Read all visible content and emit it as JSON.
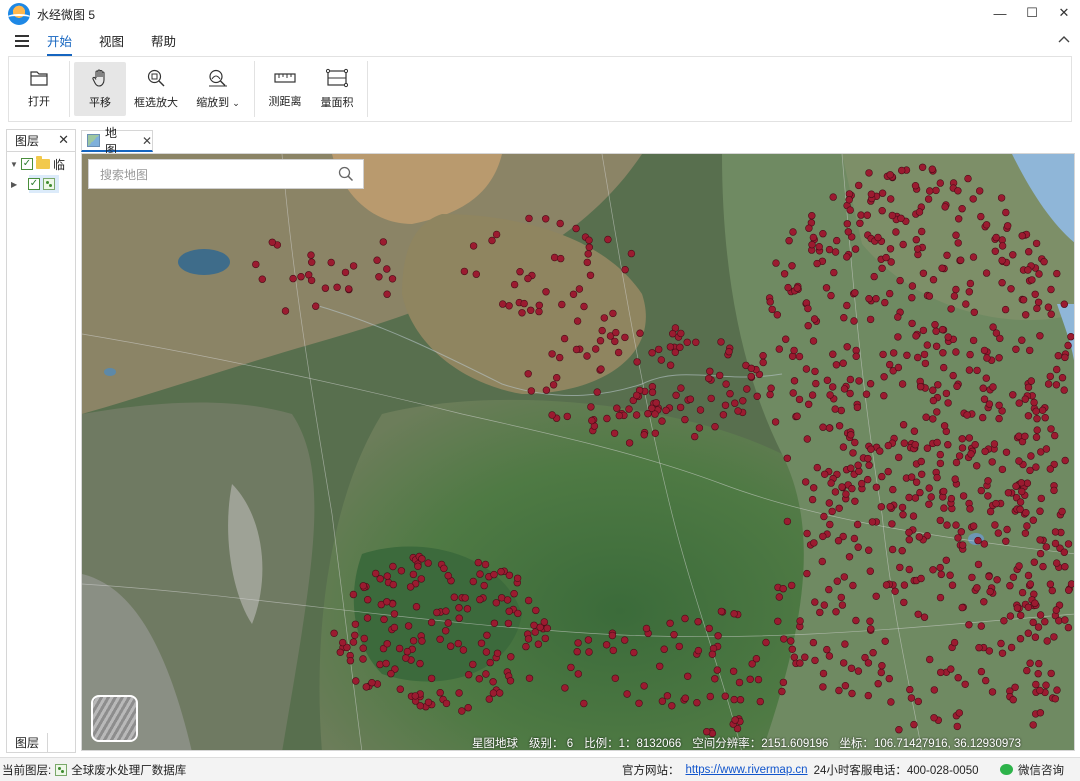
{
  "app": {
    "title": "水经微图 5"
  },
  "window": {
    "minimize": "—",
    "maximize": "☐",
    "close": "✕"
  },
  "menu": {
    "items": [
      "开始",
      "视图",
      "帮助"
    ],
    "active": "开始",
    "collapse_icon": "chevron-up-icon"
  },
  "ribbon": {
    "open": "打开",
    "pan": "平移",
    "zoom_box": "框选放大",
    "zoom_to": "缩放到",
    "measure_distance": "测距离",
    "measure_area": "量面积"
  },
  "layer_panel": {
    "title": "图层",
    "folder_label": "临",
    "bottom_tab": "图层"
  },
  "map_tab": {
    "label": "地图"
  },
  "search": {
    "placeholder": "搜索地图"
  },
  "map_status": {
    "source": "星图地球",
    "level_label": "级别：",
    "level": "6",
    "scale_label": "比例：",
    "scale": "1：8132066",
    "resolution_label": "空间分辨率：",
    "resolution": "2151.609196",
    "coords_label": "坐标：",
    "coords": "106.71427916, 36.12930973"
  },
  "statusbar": {
    "current_layer_label": "当前图层:",
    "current_layer": "全球废水处理厂数据库",
    "site_label": "官方网站：",
    "site_url": "https://www.rivermap.cn",
    "hotline": "24小时客服电话：400-028-0050",
    "wechat": "微信咨询"
  },
  "colors": {
    "accent": "#1565c0",
    "point": "#9b1b30"
  }
}
